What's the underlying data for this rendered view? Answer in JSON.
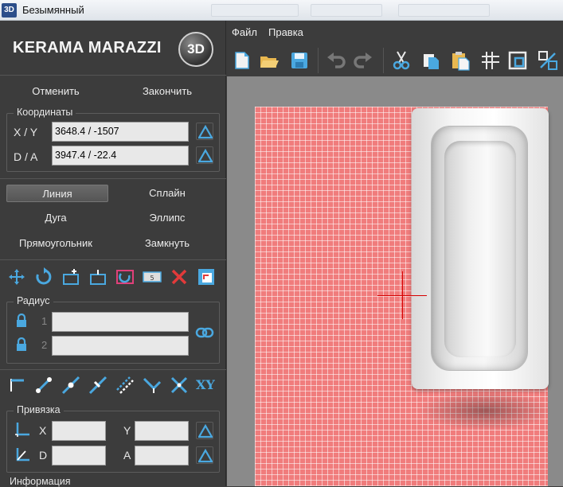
{
  "window": {
    "title": "Безымянный",
    "app_icon": "3D"
  },
  "logo": {
    "text": "KERAMA MARAZZI",
    "badge": "3D"
  },
  "actions": {
    "cancel": "Отменить",
    "finish": "Закончить"
  },
  "coordinates": {
    "title": "Координаты",
    "xy_label": "X / Y",
    "xy_value": "3648.4 / -1507",
    "da_label": "D / A",
    "da_value": "3947.4 / -22.4"
  },
  "draw_modes": {
    "line": "Линия",
    "spline": "Сплайн",
    "arc": "Дуга",
    "ellipse": "Эллипс",
    "rectangle": "Прямоугольник",
    "close": "Замкнуть",
    "selected": "line"
  },
  "edit_tools": [
    "move-icon",
    "rotate-icon",
    "add-point-icon",
    "insert-point-icon",
    "mirror-icon",
    "dimension-icon",
    "delete-icon",
    "frame-icon"
  ],
  "radius": {
    "title": "Радиус",
    "row1_num": "1",
    "row1_value": "",
    "row2_num": "2",
    "row2_value": ""
  },
  "snap_tools": [
    "line-end-icon",
    "line-nodes-icon",
    "line-midpoint-icon",
    "line-angle-icon",
    "parallel-icon",
    "bisector-icon",
    "intersection-icon"
  ],
  "snap_xy_label": "XY",
  "binding": {
    "title": "Привязка",
    "x_label": "X",
    "x_value": "",
    "y_label": "Y",
    "y_value": "",
    "d_label": "D",
    "d_value": "",
    "a_label": "A",
    "a_value": ""
  },
  "info": {
    "title": "Информация"
  },
  "menu": {
    "file": "Файл",
    "edit": "Правка"
  },
  "toolbar": [
    "new-file-icon",
    "open-folder-icon",
    "save-icon",
    "undo-icon",
    "redo-icon",
    "cut-icon",
    "copy-icon",
    "paste-icon",
    "grid-icon",
    "frame-icon",
    "scale-icon"
  ],
  "colors": {
    "accent": "#4aa8e0",
    "tile": "#f07c7c",
    "cursor": "#d60000",
    "panel": "#3c3c3c"
  }
}
